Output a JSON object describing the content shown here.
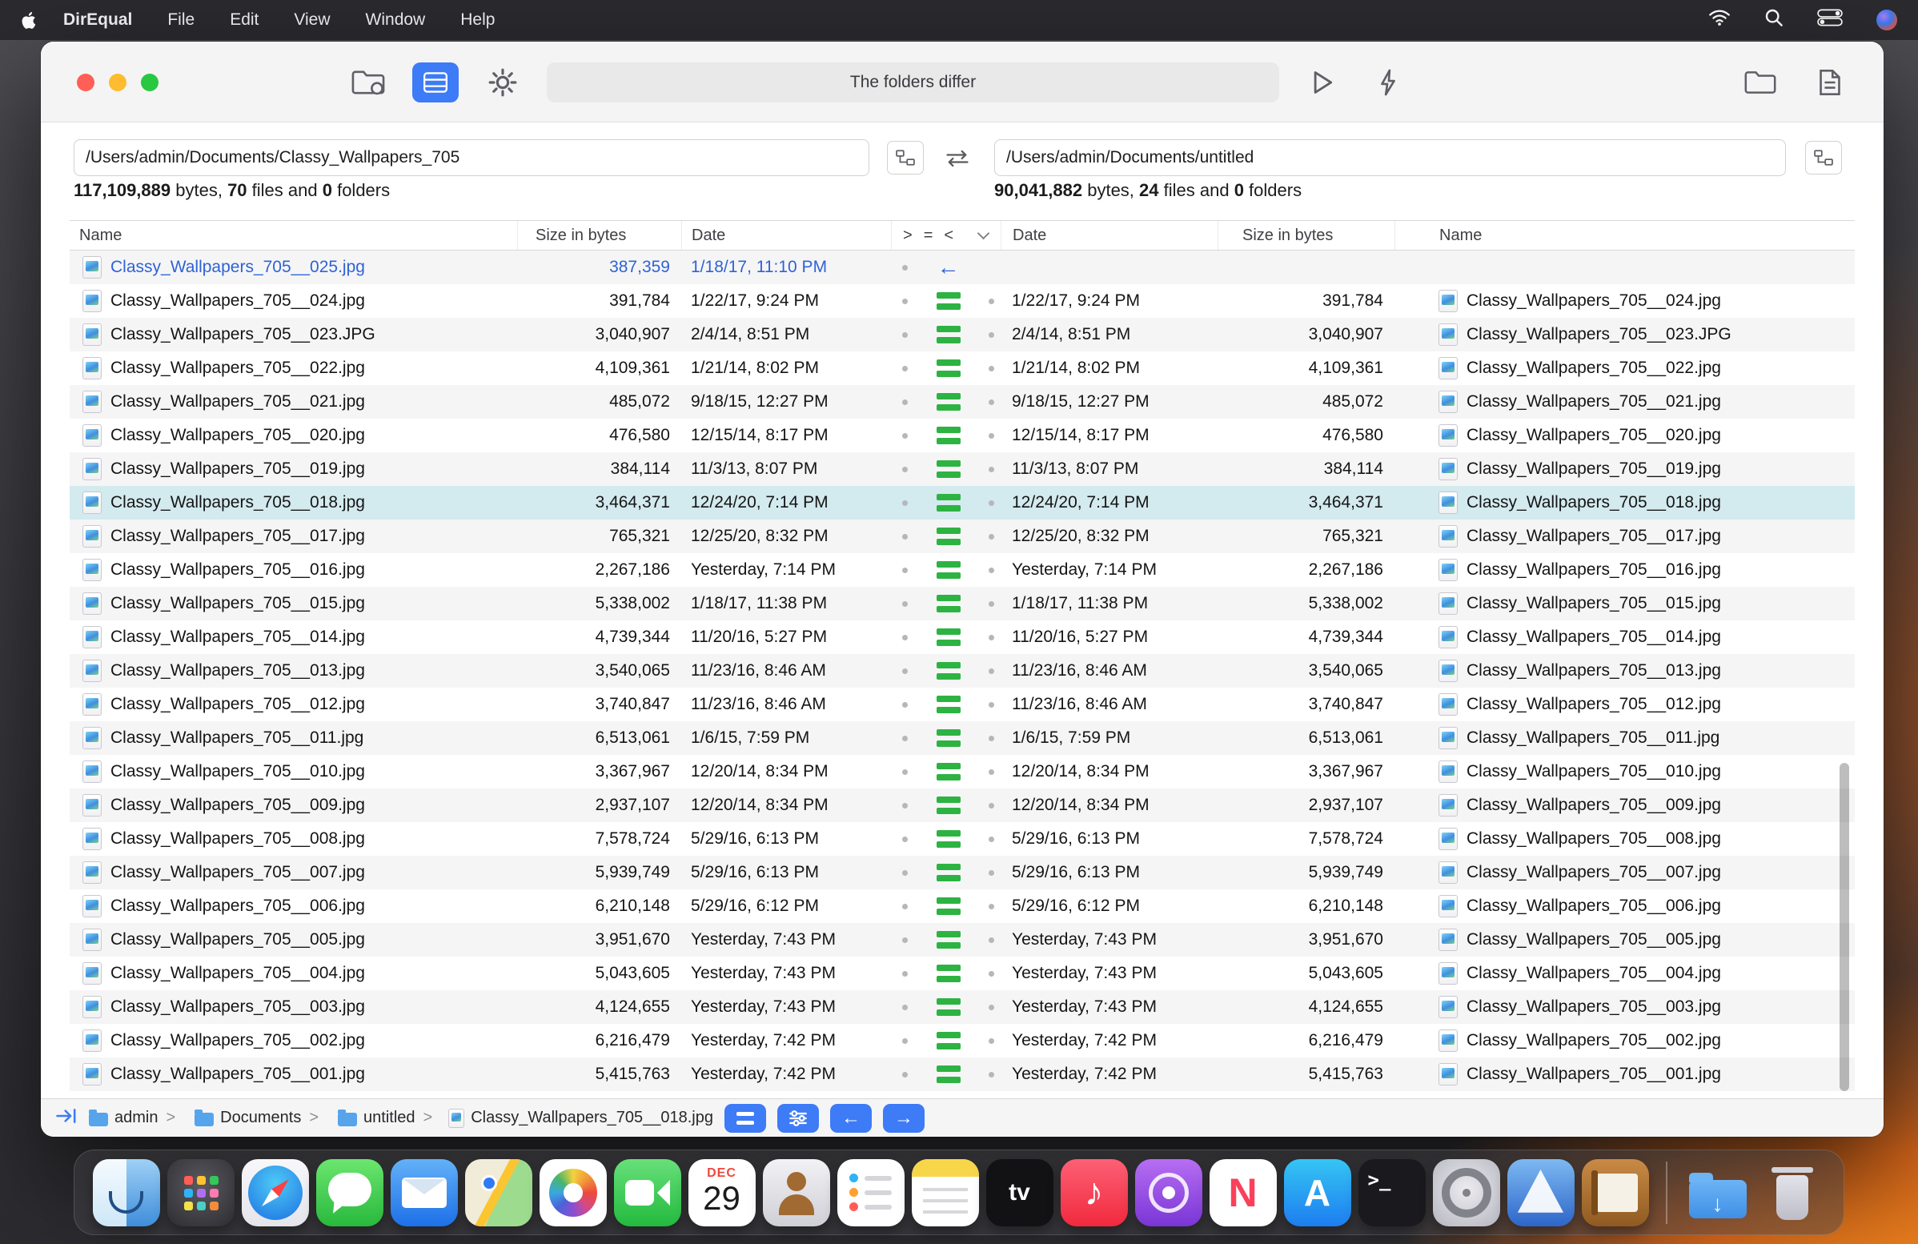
{
  "menu_bar": {
    "app_name": "DirEqual",
    "items": [
      "File",
      "Edit",
      "View",
      "Window",
      "Help"
    ]
  },
  "toolbar": {
    "title": "The folders differ"
  },
  "left_pane": {
    "path": "/Users/admin/Documents/Classy_Wallpapers_705",
    "bytes": "117,109,889",
    "files": "70",
    "folders": "0"
  },
  "right_pane": {
    "path": "/Users/admin/Documents/untitled",
    "bytes": "90,041,882",
    "files": "24",
    "folders": "0"
  },
  "labels": {
    "bytes_word": " bytes, ",
    "files_word": " files and ",
    "folders_word": " folders",
    "crumb_sep": ">"
  },
  "icons": {
    "back_arrow": "←",
    "forward_arrow": "→",
    "left_arrow": "←"
  },
  "colors": {
    "accent": "#3d7bf7",
    "equal_green": "#2db342",
    "added_blue": "#2e63d5",
    "selection": "#d3eaee"
  },
  "table": {
    "headers": {
      "name": "Name",
      "size": "Size in bytes",
      "date": "Date",
      "gt": ">",
      "eq": "=",
      "lt": "<",
      "date_right": "Date",
      "size_right": "Size in bytes",
      "name_right": "Name"
    },
    "rows": [
      {
        "name": "Classy_Wallpapers_705__025.jpg",
        "size": "387,359",
        "date": "1/18/17, 11:10 PM",
        "status": "left-only",
        "selected": false
      },
      {
        "name": "Classy_Wallpapers_705__024.jpg",
        "size": "391,784",
        "date": "1/22/17, 9:24 PM",
        "status": "equal",
        "selected": false
      },
      {
        "name": "Classy_Wallpapers_705__023.JPG",
        "size": "3,040,907",
        "date": "2/4/14, 8:51 PM",
        "status": "equal",
        "selected": false
      },
      {
        "name": "Classy_Wallpapers_705__022.jpg",
        "size": "4,109,361",
        "date": "1/21/14, 8:02 PM",
        "status": "equal",
        "selected": false
      },
      {
        "name": "Classy_Wallpapers_705__021.jpg",
        "size": "485,072",
        "date": "9/18/15, 12:27 PM",
        "status": "equal",
        "selected": false
      },
      {
        "name": "Classy_Wallpapers_705__020.jpg",
        "size": "476,580",
        "date": "12/15/14, 8:17 PM",
        "status": "equal",
        "selected": false
      },
      {
        "name": "Classy_Wallpapers_705__019.jpg",
        "size": "384,114",
        "date": "11/3/13, 8:07 PM",
        "status": "equal",
        "selected": false
      },
      {
        "name": "Classy_Wallpapers_705__018.jpg",
        "size": "3,464,371",
        "date": "12/24/20, 7:14 PM",
        "status": "equal",
        "selected": true
      },
      {
        "name": "Classy_Wallpapers_705__017.jpg",
        "size": "765,321",
        "date": "12/25/20, 8:32 PM",
        "status": "equal",
        "selected": false
      },
      {
        "name": "Classy_Wallpapers_705__016.jpg",
        "size": "2,267,186",
        "date": "Yesterday, 7:14 PM",
        "status": "equal",
        "selected": false
      },
      {
        "name": "Classy_Wallpapers_705__015.jpg",
        "size": "5,338,002",
        "date": "1/18/17, 11:38 PM",
        "status": "equal",
        "selected": false
      },
      {
        "name": "Classy_Wallpapers_705__014.jpg",
        "size": "4,739,344",
        "date": "11/20/16, 5:27 PM",
        "status": "equal",
        "selected": false
      },
      {
        "name": "Classy_Wallpapers_705__013.jpg",
        "size": "3,540,065",
        "date": "11/23/16, 8:46 AM",
        "status": "equal",
        "selected": false
      },
      {
        "name": "Classy_Wallpapers_705__012.jpg",
        "size": "3,740,847",
        "date": "11/23/16, 8:46 AM",
        "status": "equal",
        "selected": false
      },
      {
        "name": "Classy_Wallpapers_705__011.jpg",
        "size": "6,513,061",
        "date": "1/6/15, 7:59 PM",
        "status": "equal",
        "selected": false
      },
      {
        "name": "Classy_Wallpapers_705__010.jpg",
        "size": "3,367,967",
        "date": "12/20/14, 8:34 PM",
        "status": "equal",
        "selected": false
      },
      {
        "name": "Classy_Wallpapers_705__009.jpg",
        "size": "2,937,107",
        "date": "12/20/14, 8:34 PM",
        "status": "equal",
        "selected": false
      },
      {
        "name": "Classy_Wallpapers_705__008.jpg",
        "size": "7,578,724",
        "date": "5/29/16, 6:13 PM",
        "status": "equal",
        "selected": false
      },
      {
        "name": "Classy_Wallpapers_705__007.jpg",
        "size": "5,939,749",
        "date": "5/29/16, 6:13 PM",
        "status": "equal",
        "selected": false
      },
      {
        "name": "Classy_Wallpapers_705__006.jpg",
        "size": "6,210,148",
        "date": "5/29/16, 6:12 PM",
        "status": "equal",
        "selected": false
      },
      {
        "name": "Classy_Wallpapers_705__005.jpg",
        "size": "3,951,670",
        "date": "Yesterday, 7:43 PM",
        "status": "equal",
        "selected": false
      },
      {
        "name": "Classy_Wallpapers_705__004.jpg",
        "size": "5,043,605",
        "date": "Yesterday, 7:43 PM",
        "status": "equal",
        "selected": false
      },
      {
        "name": "Classy_Wallpapers_705__003.jpg",
        "size": "4,124,655",
        "date": "Yesterday, 7:43 PM",
        "status": "equal",
        "selected": false
      },
      {
        "name": "Classy_Wallpapers_705__002.jpg",
        "size": "6,216,479",
        "date": "Yesterday, 7:42 PM",
        "status": "equal",
        "selected": false
      },
      {
        "name": "Classy_Wallpapers_705__001.jpg",
        "size": "5,415,763",
        "date": "Yesterday, 7:42 PM",
        "status": "equal",
        "selected": false
      }
    ]
  },
  "status_bar": {
    "breadcrumb": [
      {
        "label": "admin",
        "type": "folder"
      },
      {
        "label": "Documents",
        "type": "folder"
      },
      {
        "label": "untitled",
        "type": "folder"
      },
      {
        "label": "Classy_Wallpapers_705__018.jpg",
        "type": "file"
      }
    ]
  },
  "dock": {
    "items": [
      {
        "name": "finder"
      },
      {
        "name": "launchpad"
      },
      {
        "name": "safari"
      },
      {
        "name": "messages"
      },
      {
        "name": "mail"
      },
      {
        "name": "maps"
      },
      {
        "name": "photos"
      },
      {
        "name": "facetime"
      },
      {
        "name": "calendar",
        "month": "DEC",
        "day": "29"
      },
      {
        "name": "contacts"
      },
      {
        "name": "reminders"
      },
      {
        "name": "notes"
      },
      {
        "name": "appletv",
        "glyph": "tv"
      },
      {
        "name": "music",
        "glyph": "♪"
      },
      {
        "name": "podcasts"
      },
      {
        "name": "news",
        "glyph": "N"
      },
      {
        "name": "appstore",
        "glyph": "A"
      },
      {
        "name": "terminal",
        "glyph": ">_"
      },
      {
        "name": "settings"
      },
      {
        "name": "direqual"
      },
      {
        "name": "dictionary"
      },
      {
        "type": "separator"
      },
      {
        "name": "downloads",
        "glyph": "↓"
      },
      {
        "name": "trash"
      }
    ]
  }
}
